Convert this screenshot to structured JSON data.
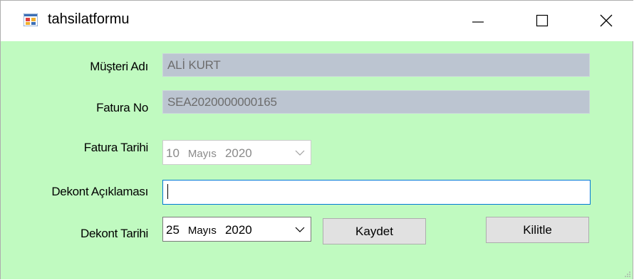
{
  "window": {
    "title": "tahsilatformu",
    "controls": [
      "minimize",
      "maximize",
      "close"
    ],
    "background_color": "#c0fac0"
  },
  "form": {
    "musteri_adi": {
      "label": "Müşteri Adı",
      "value": "ALİ KURT"
    },
    "fatura_no": {
      "label": "Fatura No",
      "value": "SEA2020000000165"
    },
    "fatura_tarihi": {
      "label": "Fatura Tarihi",
      "day": "10",
      "month": "Mayıs",
      "year": "2020"
    },
    "dekont_aciklamasi": {
      "label": "Dekont Açıklaması",
      "value": ""
    },
    "dekont_tarihi": {
      "label": "Dekont Tarihi",
      "day": "25",
      "month": "Mayıs",
      "year": "2020"
    },
    "kaydet_label": "Kaydet",
    "kilitle_label": "Kilitle"
  },
  "icons": {
    "app": "app-form-icon",
    "dropdown": "chevron-down-icon"
  }
}
